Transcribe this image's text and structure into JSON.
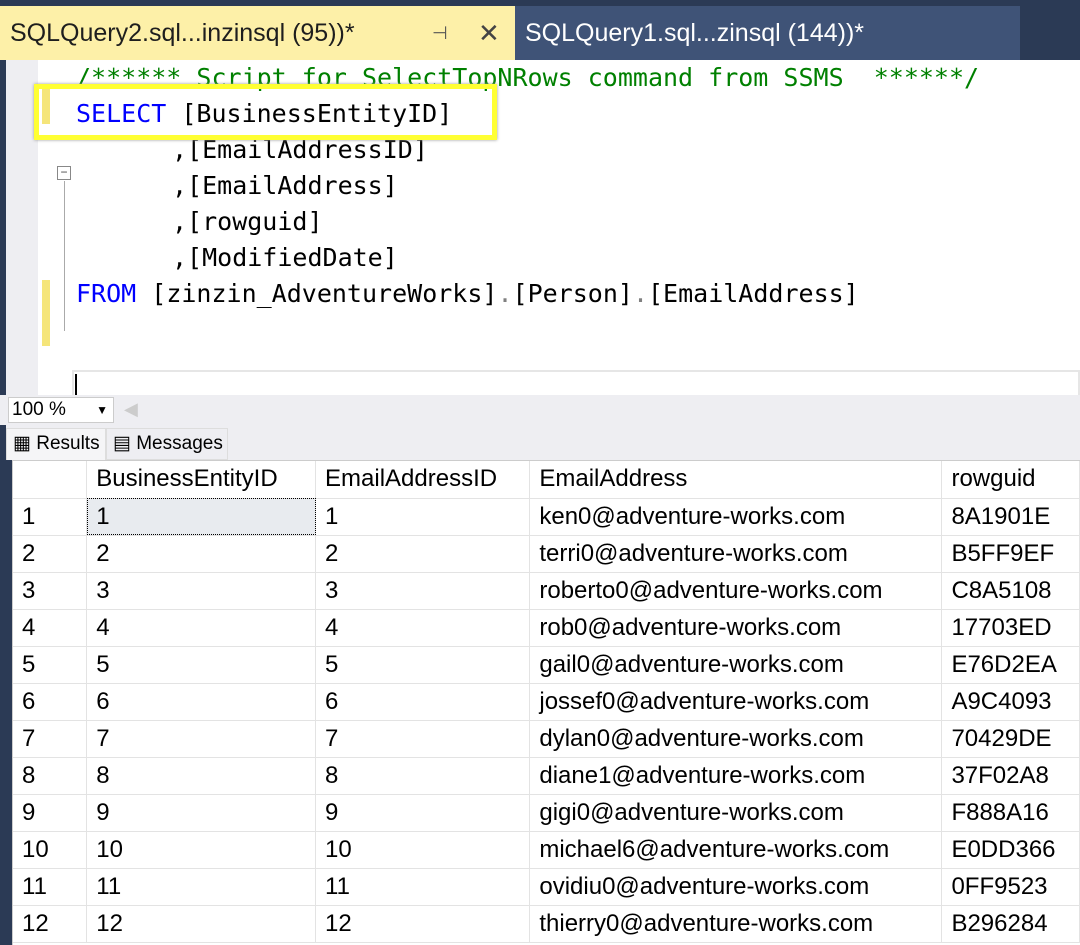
{
  "tabs": [
    {
      "label": "SQLQuery2.sql...inzinsql (95))*",
      "active": true
    },
    {
      "label": "SQLQuery1.sql...zinsql (144))*",
      "active": false
    }
  ],
  "editor": {
    "comment": "/****** Script for SelectTopNRows command from SSMS  ******/",
    "select_kw": "SELECT",
    "select_col": " [BusinessEntityID]",
    "cols": [
      ",[EmailAddressID]",
      ",[EmailAddress]",
      ",[rowguid]",
      ",[ModifiedDate]"
    ],
    "from_kw": "FROM",
    "from_db": " [zinzin_AdventureWorks]",
    "dot": ".",
    "from_schema": "[Person]",
    "from_table": "[EmailAddress]"
  },
  "zoom": {
    "value": "100 %"
  },
  "result_tabs": [
    "Results",
    "Messages"
  ],
  "grid": {
    "columns": [
      "",
      "BusinessEntityID",
      "EmailAddressID",
      "EmailAddress",
      "rowguid"
    ],
    "rows": [
      [
        "1",
        "1",
        "1",
        "ken0@adventure-works.com",
        "8A1901E"
      ],
      [
        "2",
        "2",
        "2",
        "terri0@adventure-works.com",
        "B5FF9EF"
      ],
      [
        "3",
        "3",
        "3",
        "roberto0@adventure-works.com",
        "C8A5108"
      ],
      [
        "4",
        "4",
        "4",
        "rob0@adventure-works.com",
        "17703ED"
      ],
      [
        "5",
        "5",
        "5",
        "gail0@adventure-works.com",
        "E76D2EA"
      ],
      [
        "6",
        "6",
        "6",
        "jossef0@adventure-works.com",
        "A9C4093"
      ],
      [
        "7",
        "7",
        "7",
        "dylan0@adventure-works.com",
        "70429DE"
      ],
      [
        "8",
        "8",
        "8",
        "diane1@adventure-works.com",
        "37F02A8"
      ],
      [
        "9",
        "9",
        "9",
        "gigi0@adventure-works.com",
        "F888A16"
      ],
      [
        "10",
        "10",
        "10",
        "michael6@adventure-works.com",
        "E0DD366"
      ],
      [
        "11",
        "11",
        "11",
        "ovidiu0@adventure-works.com",
        "0FF9523"
      ],
      [
        "12",
        "12",
        "12",
        "thierry0@adventure-works.com",
        "B296284"
      ]
    ]
  },
  "colors": {
    "active_tab": "#fdf0a8",
    "highlight": "#ffff33",
    "keyword": "#0000ff",
    "comment": "#008000"
  }
}
